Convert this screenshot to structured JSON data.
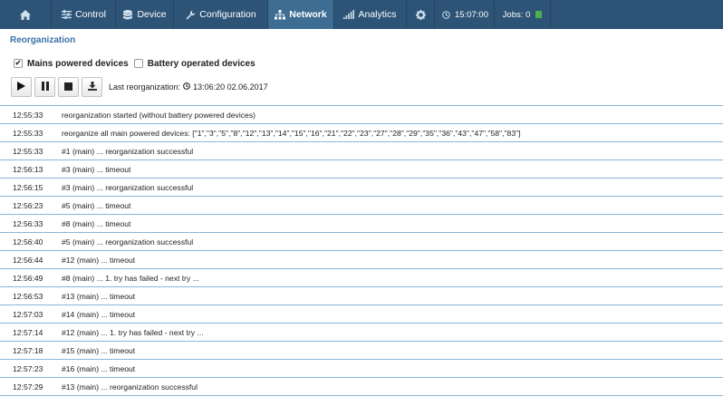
{
  "nav": {
    "home_icon": "home-icon",
    "control": "Control",
    "device": "Device",
    "configuration": "Configuration",
    "network": "Network",
    "analytics": "Analytics",
    "settings_icon": "gear-icon",
    "time": "15:07:00",
    "jobs": "Jobs: 0",
    "jobs_status_color": "#4caf50",
    "active_color": "#3e6d93"
  },
  "page": {
    "title": "Reorganization",
    "mains_label": "Mains powered devices",
    "mains_checked": true,
    "battery_label": "Battery operated devices",
    "battery_checked": false,
    "last_reorg_label": "Last reorganization:",
    "last_reorg_value": "13:06:20 02.06.2017"
  },
  "log": [
    {
      "time": "12:55:33",
      "msg": "reorganization started (without battery powered devices)"
    },
    {
      "time": "12:55:33",
      "msg": "reorganize all main powered devices: [\"1\",\"3\",\"5\",\"8\",\"12\",\"13\",\"14\",\"15\",\"16\",\"21\",\"22\",\"23\",\"27\",\"28\",\"29\",\"35\",\"36\",\"43\",\"47\",\"58\",\"83\"]"
    },
    {
      "time": "12:55:33",
      "msg": "#1 (main) ... reorganization successful"
    },
    {
      "time": "12:56:13",
      "msg": "#3 (main) ... timeout"
    },
    {
      "time": "12:56:15",
      "msg": "#3 (main) ... reorganization successful"
    },
    {
      "time": "12:56:23",
      "msg": "#5 (main) ... timeout"
    },
    {
      "time": "12:56:33",
      "msg": "#8 (main) ... timeout"
    },
    {
      "time": "12:56:40",
      "msg": "#5 (main) ... reorganization successful"
    },
    {
      "time": "12:56:44",
      "msg": "#12 (main) ... timeout"
    },
    {
      "time": "12:56:49",
      "msg": "#8 (main) ... 1. try has failed - next try ..."
    },
    {
      "time": "12:56:53",
      "msg": "#13 (main) ... timeout"
    },
    {
      "time": "12:57:03",
      "msg": "#14 (main) ... timeout"
    },
    {
      "time": "12:57:14",
      "msg": "#12 (main) ... 1. try has failed - next try ..."
    },
    {
      "time": "12:57:18",
      "msg": "#15 (main) ... timeout"
    },
    {
      "time": "12:57:23",
      "msg": "#16 (main) ... timeout"
    },
    {
      "time": "12:57:29",
      "msg": "#13 (main) ... reorganization successful"
    }
  ]
}
